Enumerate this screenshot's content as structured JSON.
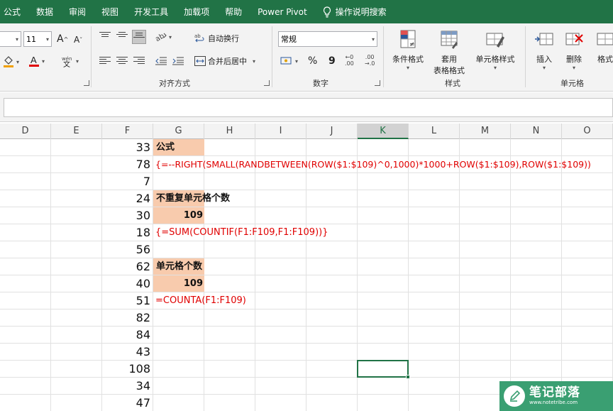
{
  "menu": [
    "公式",
    "数据",
    "审阅",
    "视图",
    "开发工具",
    "加载项",
    "帮助",
    "Power Pivot"
  ],
  "tell_me": "操作说明搜索",
  "ribbon": {
    "font_size": "11",
    "wrap_text": "自动换行",
    "merge_center": "合并后居中",
    "number_format": "常规",
    "percent": "%",
    "comma": "9",
    "alignment_label": "对齐方式",
    "number_label": "数字",
    "conditional_format": "条件格式",
    "table_format_1": "套用",
    "table_format_2": "表格格式",
    "cell_styles": "单元格样式",
    "styles_label": "样式",
    "insert": "插入",
    "delete": "删除",
    "format": "格式",
    "cells_label": "单元格"
  },
  "columns": [
    "D",
    "E",
    "F",
    "G",
    "H",
    "I",
    "J",
    "K",
    "L",
    "M",
    "N",
    "O"
  ],
  "selected_column": "K",
  "f_values": [
    "33",
    "78",
    "7",
    "24",
    "30",
    "18",
    "56",
    "62",
    "40",
    "51",
    "82",
    "84",
    "43",
    "108",
    "34",
    "47"
  ],
  "g_cells": {
    "title": "公式",
    "formula1": "{=--RIGHT(SMALL(RANDBETWEEN(ROW($1:$109)^0,1000)*1000+ROW($1:$109),ROW($1:$109))",
    "unique_label": "不重复单元格个数",
    "unique_value": "109",
    "formula2": "{=SUM(COUNTIF(F1:F109,F1:F109))}",
    "count_label": "单元格个数",
    "count_value": "109",
    "formula3": "=COUNTA(F1:F109)"
  },
  "watermark": {
    "main": "笔记部落",
    "sub": "www.notetribe.com"
  },
  "colors": {
    "accent": "#217346",
    "peach": "#f8cbad",
    "formula_red": "#e00000"
  }
}
